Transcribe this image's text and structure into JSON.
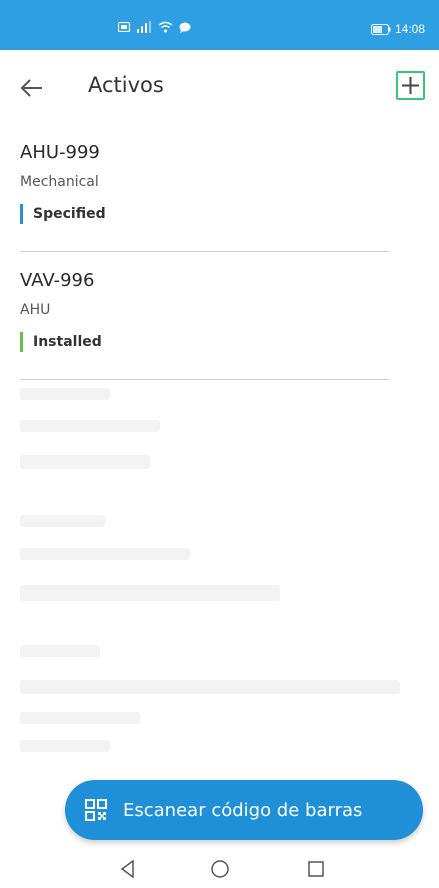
{
  "status_bar": {
    "time": "14:08",
    "icons": [
      "sim-icon",
      "signal-icon",
      "wifi-icon",
      "chat-icon",
      "battery-icon"
    ],
    "background": "#2d9fe2"
  },
  "app_bar": {
    "title": "Activos",
    "add_button_icon": "plus-icon",
    "add_button_color": "#3cc47c"
  },
  "assets": [
    {
      "name": "AHU-999",
      "type": "Mechanical",
      "status": "Specified",
      "status_color": "#2d8fd0"
    },
    {
      "name": "VAV-996",
      "type": "AHU",
      "status": "Installed",
      "status_color": "#6cc04a"
    }
  ],
  "scan_button": {
    "label": "Escanear código de barras",
    "icon": "qr-code-icon",
    "color": "#1f8fd8"
  },
  "nav_bar": {
    "buttons": [
      "back-triangle-icon",
      "home-circle-icon",
      "recents-square-icon"
    ]
  }
}
